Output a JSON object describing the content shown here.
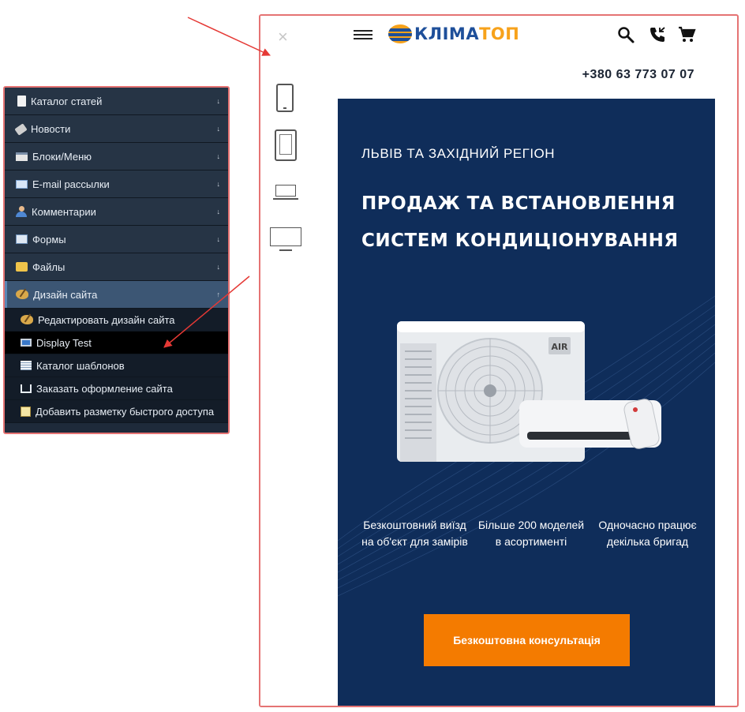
{
  "admin_menu": {
    "items": [
      {
        "label": "Каталог статей",
        "icon": "document-icon",
        "arrow": "↓"
      },
      {
        "label": "Новости",
        "icon": "newspaper-icon",
        "arrow": "↓"
      },
      {
        "label": "Блоки/Меню",
        "icon": "blocks-icon",
        "arrow": "↓"
      },
      {
        "label": "E-mail рассылки",
        "icon": "mail-icon",
        "arrow": "↓"
      },
      {
        "label": "Комментарии",
        "icon": "comment-user-icon",
        "arrow": "↓"
      },
      {
        "label": "Формы",
        "icon": "form-icon",
        "arrow": "↓"
      },
      {
        "label": "Файлы",
        "icon": "folder-icon",
        "arrow": "↓"
      },
      {
        "label": "Дизайн сайта",
        "icon": "palette-icon",
        "arrow": "↑"
      }
    ],
    "submenu": [
      {
        "label": "Редактировать дизайн сайта",
        "icon": "palette-icon"
      },
      {
        "label": "Display Test",
        "icon": "monitor-icon"
      },
      {
        "label": "Каталог шаблонов",
        "icon": "table-icon"
      },
      {
        "label": "Заказать оформление сайта",
        "icon": "cart-icon"
      },
      {
        "label": "Добавить разметку быстрого доступа",
        "icon": "note-icon"
      }
    ]
  },
  "preview": {
    "close": "×",
    "devices": [
      "phone-icon",
      "tablet-icon",
      "laptop-icon",
      "desktop-icon"
    ]
  },
  "site": {
    "logo": {
      "part1": "КЛІМА",
      "part2": "ТОП"
    },
    "phone": "+380 63 773 07 07",
    "hero": {
      "region": "ЛЬВІВ ТА ЗАХІДНИЙ РЕГІОН",
      "headline_line1": "ПРОДАЖ ТА ВСТАНОВЛЕННЯ",
      "headline_line2": "СИСТЕМ КОНДИЦІОНУВАННЯ",
      "ac_label": "AIR",
      "features": [
        "Безкоштовний виїзд на об'єкт для замірів",
        "Більше 200 моделей в асортименті",
        "Одночасно працює декілька бригад"
      ],
      "cta": "Безкоштовна консультація"
    }
  },
  "colors": {
    "hero_bg": "#0f2d5a",
    "cta": "#f47b00",
    "logo_blue": "#1e4f9a",
    "logo_orange": "#f7a21b",
    "highlight_border": "#e57373",
    "annotation_arrow": "#e53935"
  }
}
